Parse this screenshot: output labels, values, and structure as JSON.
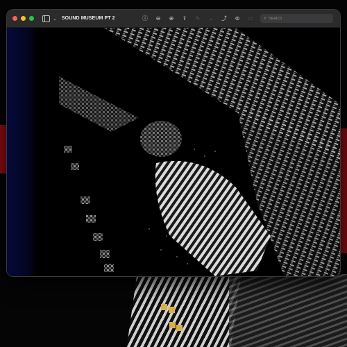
{
  "window": {
    "title": "SOUND MUSEUM PT 2"
  },
  "toolbar": {
    "search_placeholder": "Search",
    "icons": [
      "sidebar-icon",
      "chevron-down-icon",
      "info-icon",
      "zoom-out-icon",
      "zoom-in-icon",
      "share-icon",
      "markup-icon",
      "markup-menu-chevron-icon",
      "rotate-icon",
      "annotate-icon",
      "form-fill-icon",
      "search-icon"
    ]
  },
  "content": {
    "description_colors": {
      "left_strip": "#060a3a",
      "accent_red": "#8a0d12",
      "window_lights": "#d8b04a"
    }
  }
}
